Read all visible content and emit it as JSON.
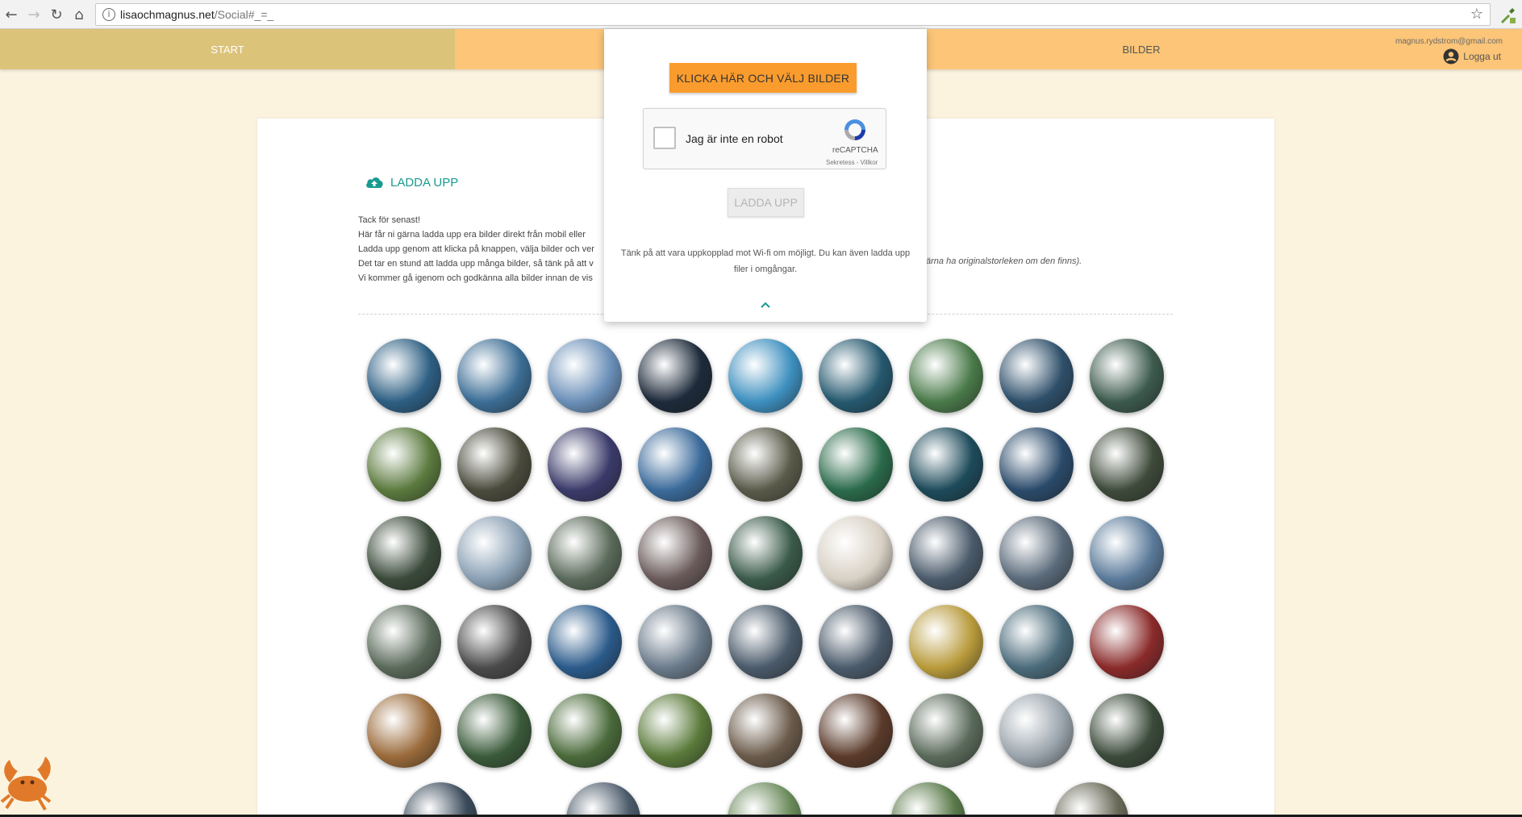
{
  "browser": {
    "url_host": "lisaochmagnus.net",
    "url_path": "/Social#_=_",
    "back_icon": "←",
    "forward_icon": "→",
    "reload_icon": "↻",
    "home_icon": "⌂",
    "info_icon": "i",
    "star_icon": "☆"
  },
  "nav": {
    "start_label": "START",
    "bilder_label": "BILDER",
    "user_email": "magnus.rydstrom@gmail.com",
    "logout_label": "Logga ut"
  },
  "upload": {
    "heading": "LADDA UPP",
    "intro_lines": [
      "Tack för senast!",
      "Här får ni gärna ladda upp era bilder direkt från mobil eller",
      "Ladda upp genom att klicka på knappen, välja bilder och ver",
      "Det tar en stund att ladda upp många bilder, så tänk på att v",
      "Vi kommer gå igenom och godkänna alla bilder innan de vis"
    ],
    "intro_tail": "ärna ha originalstorleken om den finns)."
  },
  "modal": {
    "choose_button": "KLICKA HÄR OCH VÄLJ BILDER",
    "captcha_label": "Jag är inte en robot",
    "captcha_brand": "reCAPTCHA",
    "captcha_terms": "Sekretess - Villkor",
    "upload_button": "LADDA UPP",
    "note": "Tänk på att vara uppkopplad mot Wi-fi om möjligt. Du kan även ladda upp filer i omgångar."
  },
  "colors": {
    "nav_bar": "#fcc577",
    "nav_active": "#dcc37a",
    "accent_teal": "#199a8f",
    "button_orange": "#fa9c2d",
    "page_bg": "#fcf3df"
  },
  "photos": [
    [
      "#2d5f83",
      "#3b6d95",
      "#6a8fb8",
      "#1d2a3a",
      "#3d8fbf",
      "#25586e",
      "#4a7a4a",
      "#2e4f6a",
      "#3c5a4d"
    ],
    [
      "#5b7a3e",
      "#4a4a3c",
      "#3a3a6a",
      "#3a6a9a",
      "#5a5a4a",
      "#2a6a4a",
      "#1d4a5a",
      "#2a4a6a",
      "#3e4a3a"
    ],
    [
      "#3a4a3a",
      "#8aa0b4",
      "#5a6a5a",
      "#6a5a5a",
      "#3a5a4a",
      "#d8d0c4",
      "#4a5a6a",
      "#5a6a7a",
      "#5a7a9a"
    ],
    [
      "#5a6a5a",
      "#4a4a4a",
      "#2a5a8a",
      "#6a7a8a",
      "#4a5a6a",
      "#4a5a6a",
      "#b89a3a",
      "#4a6a7a",
      "#8a2a2a"
    ],
    [
      "#9a6a3a",
      "#3a5a3a",
      "#4a6a3a",
      "#5a7a3a",
      "#6a5a4a",
      "#5a3a2a",
      "#5a6a5a",
      "#9aa4ac",
      "#3a4a3a"
    ],
    [
      "#3a4a5a",
      "#4a5a6a",
      "#6a8a5a",
      "#5a7a4a",
      "#6a6a5a"
    ]
  ]
}
